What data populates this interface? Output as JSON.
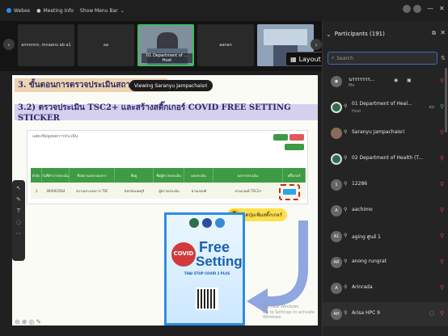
{
  "topbar": {
    "items": [
      "Webex",
      "Meeting Info",
      "Show Menu Bar"
    ],
    "window_controls": [
      "—",
      "✕"
    ]
  },
  "strip": {
    "thumbs": [
      {
        "label": "annnnnn, mnaanu ab a1",
        "kind": "name"
      },
      {
        "label": "aa",
        "kind": "name"
      },
      {
        "label": "01 Department of ... Host",
        "kind": "video"
      },
      {
        "label": "aanan",
        "kind": "name"
      },
      {
        "label": "",
        "kind": "video"
      }
    ],
    "layout_label": "Layout"
  },
  "slide": {
    "heading1": "3. ขั้นตอนการตรวจประเมินสถานประกอบ",
    "heading2": "3.2) ตรวจประเมิน TSC2+ และสร้างสติ๊กเกอร์ COVID FREE SETTING STICKER",
    "viewing": "Viewing Saranyu Jampachaisri",
    "form_title": "แสดงข้อมูลผลการประเมิน",
    "table_headers": [
      "ลำดับ",
      "วันที่ทำการประเมิน",
      "ชื่อสถานประกอบการ",
      "ที่อยู่",
      "ชื่อผู้ตรวจประเมิน",
      "ผลประเมิน",
      "ผลการประเมิน",
      "สติ๊กเกอร์"
    ],
    "table_row": [
      "1",
      "09/09/2564",
      "สถานประกอบการ TSC",
      "จังหวัดนนทบุรี",
      "ผู้ตรวจประเมิน",
      "ผ่านเกณฑ์",
      "ผ่านเกณฑ์ TSC2+",
      ""
    ],
    "step_number": "9",
    "step_text": "กดปุ่มเพิ่มสติ๊กเกอร์",
    "sticker": {
      "free": "Free",
      "setting": "Setting",
      "covid": "COVID",
      "thai_line": "THAI STOP COVID 2 PLUS"
    },
    "activate": [
      "Activate Windows",
      "Go to Settings to activate Windows."
    ],
    "colors": {
      "green": "#3e9a44",
      "red_dash": "#d42020",
      "yellow": "#ffe04a",
      "blue": "#2e8de0"
    }
  },
  "panel": {
    "title": "Participants (191)",
    "search_placeholder": "Search",
    "participants": [
      {
        "initials": "",
        "name": "นรรรรรรร...",
        "sub": "Me",
        "icon": "person-icon"
      },
      {
        "initials": "",
        "name": "01 Department of Heal...",
        "sub": "Host",
        "icon": "logo-icon"
      },
      {
        "initials": "",
        "name": "Saranyu Jampachaisri",
        "sub": "",
        "icon": "photo-icon"
      },
      {
        "initials": "",
        "name": "02 Department of Health (T...",
        "sub": "",
        "icon": "logo-icon"
      },
      {
        "initials": "1",
        "name": "12286",
        "sub": "",
        "icon": "initial-icon"
      },
      {
        "initials": "",
        "name": "aachimo",
        "sub": "",
        "icon": "initial-icon"
      },
      {
        "initials": "A1",
        "name": "aging ศูนย์ 1",
        "sub": "",
        "icon": "initial-icon"
      },
      {
        "initials": "AR",
        "name": "anong rungrat",
        "sub": "",
        "icon": "initial-icon"
      },
      {
        "initials": "",
        "name": "Arinrada",
        "sub": "",
        "icon": "initial-icon"
      },
      {
        "initials": "AH",
        "name": "Arisa HPC 9",
        "sub": "",
        "icon": "initial-icon"
      }
    ]
  }
}
